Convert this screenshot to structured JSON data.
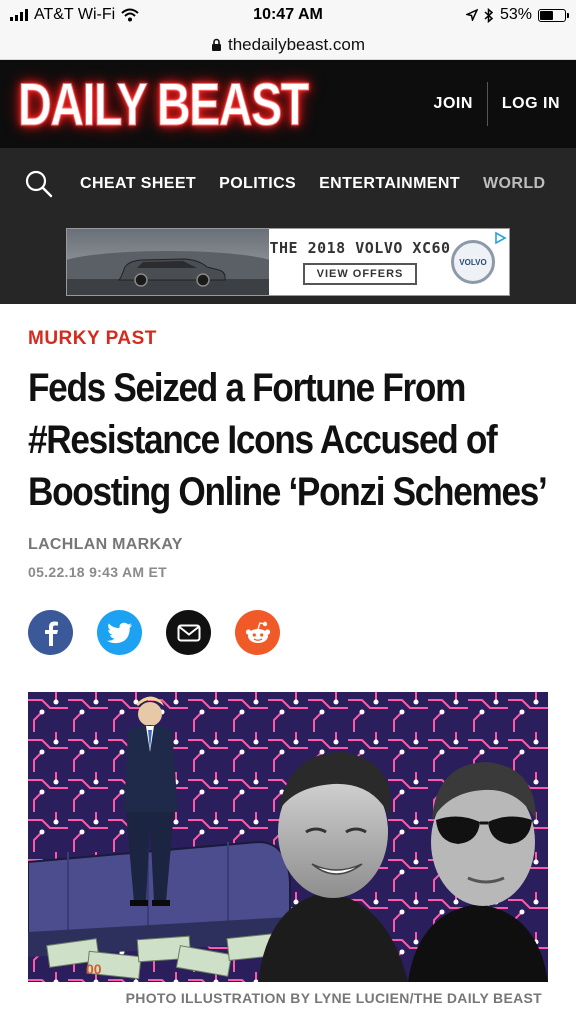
{
  "status_bar": {
    "carrier": "AT&T Wi-Fi",
    "time": "10:47 AM",
    "battery": "53%",
    "battery_level": 0.53
  },
  "browser": {
    "url": "thedailybeast.com"
  },
  "header": {
    "logo": "DAILY BEAST",
    "join_label": "JOIN",
    "login_label": "LOG IN"
  },
  "nav": {
    "items": [
      "CHEAT SHEET",
      "POLITICS",
      "ENTERTAINMENT",
      "WORLD"
    ]
  },
  "ad": {
    "title": "THE 2018 VOLVO XC60",
    "button_label": "VIEW OFFERS",
    "logo_text": "VOLVO"
  },
  "article": {
    "kicker": "MURKY PAST",
    "headline": "Feds Seized a Fortune From #Resistance Icons Accused of Boosting Online ‘Ponzi Schemes’",
    "author": "LACHLAN MARKAY",
    "date": "05.22.18 9:43 AM ET",
    "caption": "PHOTO ILLUSTRATION BY LYNE LUCIEN/THE DAILY BEAST"
  },
  "share": {
    "icons": [
      "facebook-icon",
      "twitter-icon",
      "email-icon",
      "reddit-icon"
    ],
    "colors": {
      "facebook": "#3b5998",
      "twitter": "#1da1f2",
      "email": "#111111",
      "reddit": "#f05a28"
    }
  },
  "colors": {
    "brand_red": "#d52b1e",
    "header_bg": "#0d0d0d",
    "nav_bg": "#262626"
  }
}
